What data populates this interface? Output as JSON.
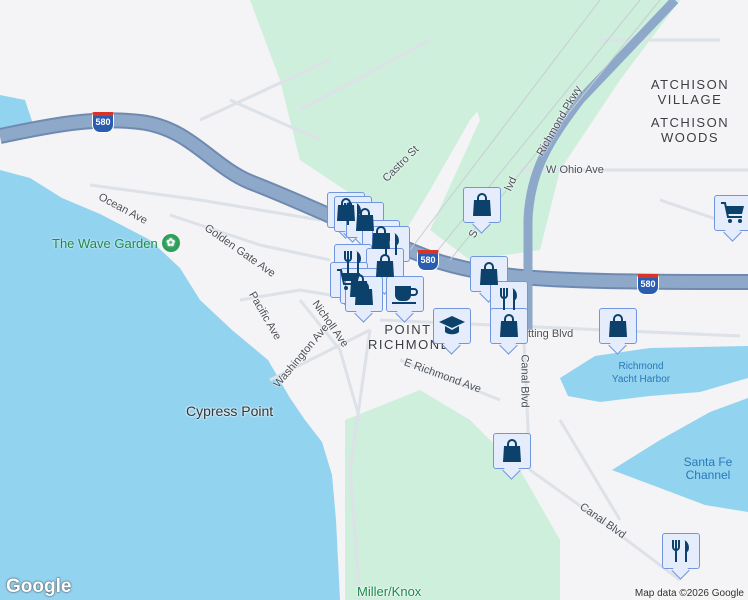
{
  "map": {
    "streets": {
      "ocean_ave": "Ocean Ave",
      "golden_gate_ave": "Golden Gate Ave",
      "pacific_ave": "Pacific Ave",
      "nicholl_ave": "Nicholl Ave",
      "washington_ave": "Washington Ave",
      "castro_st": "Castro St",
      "richmond_pkwy": "Richmond Pkwy",
      "w_ohio_ave": "W Ohio Ave",
      "e_richmond_ave": "E Richmond Ave",
      "cutting_blvd": "tting Blvd",
      "canal_blvd_1": "Canal Blvd",
      "canal_blvd_2": "Canal Blvd",
      "garrard_s": "S",
      "garrard_blvd": "lvd"
    },
    "neighborhoods": {
      "atchison_village": "ATCHISON VILLAGE",
      "atchison_woods": "ATCHISON WOODS",
      "point_richmond": "POINT RICHMOND"
    },
    "places": {
      "wave_garden": "The Wave Garden",
      "cypress_point": "Cypress Point",
      "miller_knox": "Miller/Knox"
    },
    "water": {
      "yacht_harbor": "Richmond Yacht Harbor",
      "santa_fe_channel": "Santa Fe Channel"
    },
    "highway_shields": [
      "580",
      "580",
      "580"
    ],
    "markers": [
      "shopping",
      "restaurant",
      "shopping",
      "shopping",
      "restaurant",
      "restaurant",
      "shopping",
      "cart",
      "shopping",
      "shopping",
      "coffee",
      "shopping",
      "shopping",
      "restaurant",
      "shopping",
      "school",
      "shopping",
      "cart",
      "shopping",
      "restaurant"
    ],
    "colors": {
      "water": "#92d3f0",
      "land": "#f4f3f5",
      "park": "#cdefdc",
      "highway": "#8aa3c6",
      "marker_bg": "#e5edfd",
      "marker_border": "#7096e0",
      "icon": "#0b416b"
    }
  },
  "footer": {
    "logo": "Google",
    "attribution": "Map data ©2026 Google"
  }
}
